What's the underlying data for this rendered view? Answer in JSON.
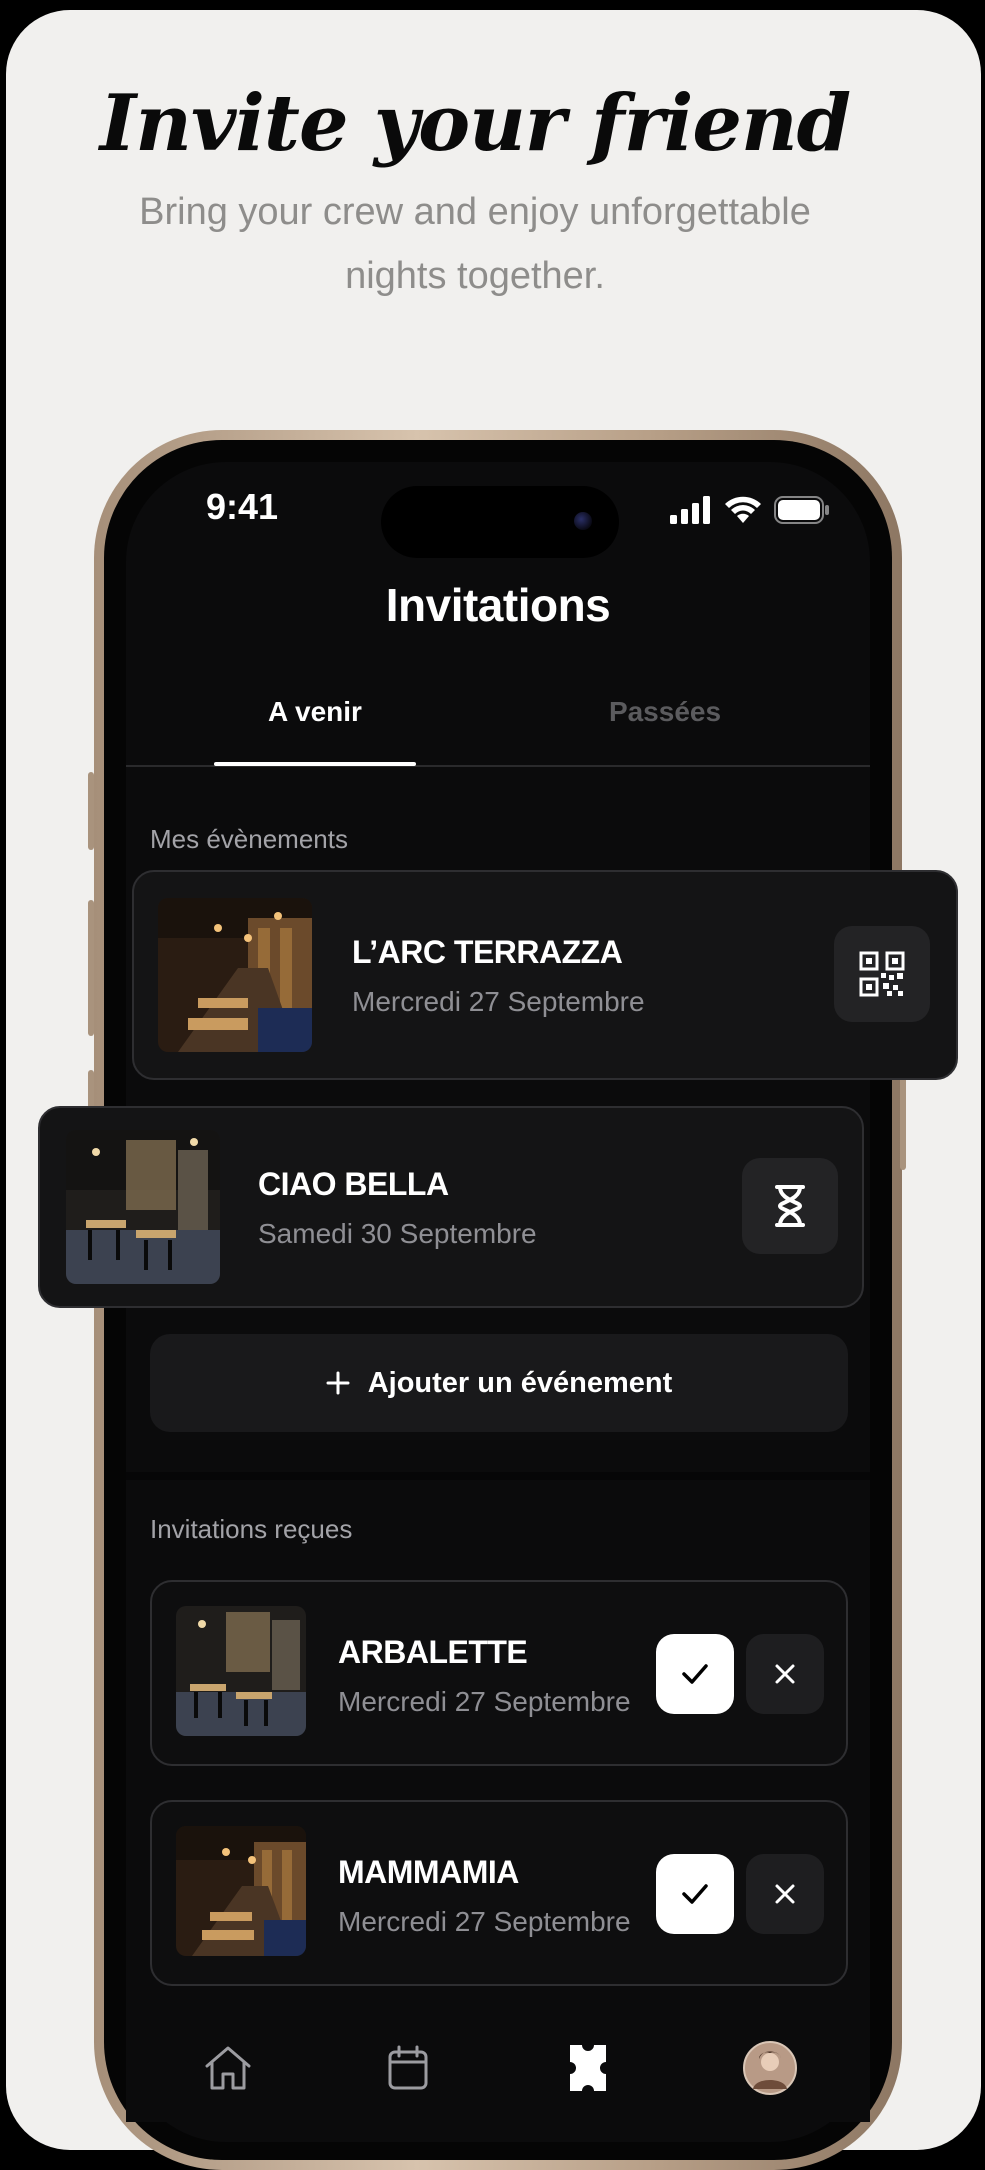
{
  "promo": {
    "headline": "Invite your friend",
    "subline": "Bring your crew and enjoy unforgettable nights together."
  },
  "status_bar": {
    "time": "9:41",
    "icons": [
      "cellular-signal-icon",
      "wifi-icon",
      "battery-icon"
    ]
  },
  "screen": {
    "title": "Invitations",
    "tabs": [
      {
        "label": "A venir",
        "active": true
      },
      {
        "label": "Passées",
        "active": false
      }
    ]
  },
  "my_events": {
    "label": "Mes évènements",
    "items": [
      {
        "name": "L’ARC TERRAZZA",
        "date": "Mercredi 27 Septembre",
        "action_icon": "qr-code-icon"
      },
      {
        "name": "CIAO BELLA",
        "date": "Samedi 30 Septembre",
        "action_icon": "hourglass-icon"
      }
    ],
    "add_label": "Ajouter un événement"
  },
  "received": {
    "label": "Invitations reçues",
    "items": [
      {
        "name": "ARBALETTE",
        "date": "Mercredi 27 Septembre"
      },
      {
        "name": "MAMMAMIA",
        "date": "Mercredi 27 Septembre"
      }
    ]
  },
  "tab_bar": {
    "items": [
      "home-icon",
      "calendar-icon",
      "ticket-icon",
      "profile-avatar"
    ],
    "active": "ticket-icon"
  },
  "colors": {
    "background": "#f1f0ee",
    "screen": "#0b0b0c",
    "card": "#141415",
    "accent": "#ffffff",
    "muted_text": "#8f8f94"
  }
}
